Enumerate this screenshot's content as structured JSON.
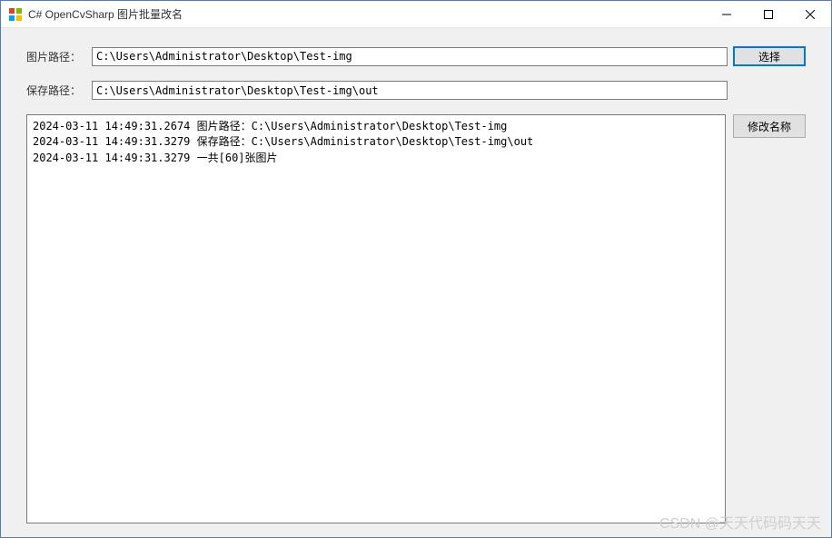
{
  "window": {
    "title": "C# OpenCvSharp 图片批量改名"
  },
  "labels": {
    "image_path": "图片路径：",
    "save_path": "保存路径："
  },
  "inputs": {
    "image_path_value": "C:\\Users\\Administrator\\Desktop\\Test-img",
    "save_path_value": "C:\\Users\\Administrator\\Desktop\\Test-img\\out"
  },
  "buttons": {
    "select": "选择",
    "rename": "修改名称"
  },
  "log": {
    "lines": [
      "2024-03-11 14:49:31.2674 图片路径：C:\\Users\\Administrator\\Desktop\\Test-img",
      "2024-03-11 14:49:31.3279 保存路径：C:\\Users\\Administrator\\Desktop\\Test-img\\out",
      "2024-03-11 14:49:31.3279 一共[60]张图片"
    ]
  },
  "watermark": "CSDN @天天代码码天天"
}
